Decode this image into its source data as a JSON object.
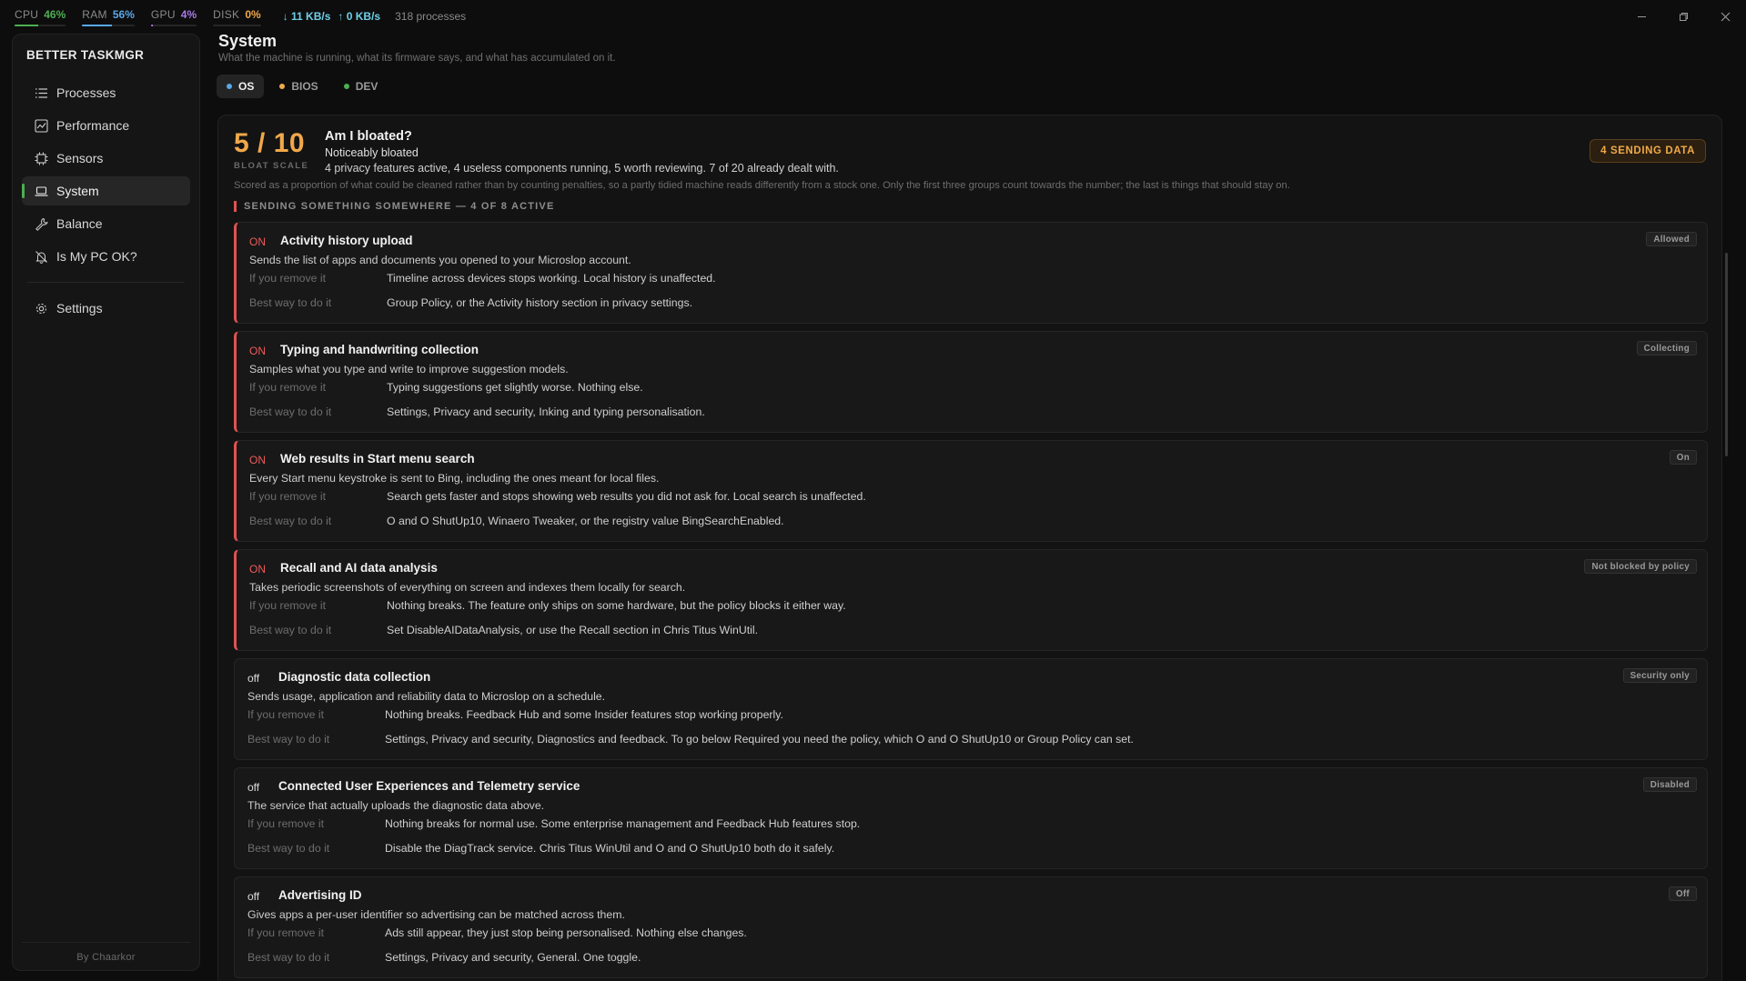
{
  "stats": [
    {
      "label": "CPU",
      "value": "46%",
      "percent": 46,
      "color": "#4caf50"
    },
    {
      "label": "RAM",
      "value": "56%",
      "percent": 56,
      "color": "#5aa7e8"
    },
    {
      "label": "GPU",
      "value": "4%",
      "percent": 4,
      "color": "#a879e8"
    },
    {
      "label": "DISK",
      "value": "0%",
      "percent": 0,
      "color": "#f0a84a"
    }
  ],
  "net": {
    "down": "↓ 11 KB/s",
    "up": "↑ 0 KB/s"
  },
  "processes": "318 processes",
  "sidebar": {
    "brand": "BETTER TASKMGR",
    "items": [
      {
        "label": "Processes",
        "icon": "list-icon"
      },
      {
        "label": "Performance",
        "icon": "chart-icon"
      },
      {
        "label": "Sensors",
        "icon": "chip-icon"
      },
      {
        "label": "System",
        "icon": "laptop-icon"
      },
      {
        "label": "Balance",
        "icon": "wrench-icon"
      },
      {
        "label": "Is My PC OK?",
        "icon": "bell-off-icon"
      }
    ],
    "settings": "Settings",
    "footer": "By Chaarkor"
  },
  "page": {
    "title": "System",
    "subtitle": "What the machine is running, what its firmware says, and what has accumulated on it.",
    "tabs": [
      {
        "label": "OS",
        "dot": "#5aa7e8"
      },
      {
        "label": "BIOS",
        "dot": "#f0a84a"
      },
      {
        "label": "DEV",
        "dot": "#4caf50"
      }
    ]
  },
  "bloat": {
    "score": "5 / 10",
    "scale_label": "BLOAT SCALE",
    "question": "Am I bloated?",
    "answer": "Noticeably bloated",
    "summary": "4 privacy features active, 4 useless components running, 5 worth reviewing. 7 of 20 already dealt with.",
    "note": "Scored as a proportion of what could be cleaned rather than by counting penalties, so a partly tidied machine reads differently from a stock one. Only the first three groups count towards the number; the last is things that should stay on.",
    "badge": "4 SENDING DATA",
    "section": "SENDING SOMETHING SOMEWHERE — 4 OF 8 ACTIVE"
  },
  "labels": {
    "remove": "If you remove it",
    "best": "Best way to do it"
  },
  "items": [
    {
      "state": "ON",
      "on": true,
      "name": "Activity history upload",
      "tag": "Allowed",
      "desc": "Sends the list of apps and documents you opened to your Microslop account.",
      "remove": "Timeline across devices stops working. Local history is unaffected.",
      "best": "Group Policy, or the Activity history section in privacy settings."
    },
    {
      "state": "ON",
      "on": true,
      "name": "Typing and handwriting collection",
      "tag": "Collecting",
      "desc": "Samples what you type and write to improve suggestion models.",
      "remove": "Typing suggestions get slightly worse. Nothing else.",
      "best": "Settings, Privacy and security, Inking and typing personalisation."
    },
    {
      "state": "ON",
      "on": true,
      "name": "Web results in Start menu search",
      "tag": "On",
      "desc": "Every Start menu keystroke is sent to Bing, including the ones meant for local files.",
      "remove": "Search gets faster and stops showing web results you did not ask for. Local search is unaffected.",
      "best": "O and O ShutUp10, Winaero Tweaker, or the registry value BingSearchEnabled."
    },
    {
      "state": "ON",
      "on": true,
      "name": "Recall and AI data analysis",
      "tag": "Not blocked by policy",
      "desc": "Takes periodic screenshots of everything on screen and indexes them locally for search.",
      "remove": "Nothing breaks. The feature only ships on some hardware, but the policy blocks it either way.",
      "best": "Set DisableAIDataAnalysis, or use the Recall section in Chris Titus WinUtil."
    },
    {
      "state": "off",
      "on": false,
      "name": "Diagnostic data collection",
      "tag": "Security only",
      "desc": "Sends usage, application and reliability data to Microslop on a schedule.",
      "remove": "Nothing breaks. Feedback Hub and some Insider features stop working properly.",
      "best": "Settings, Privacy and security, Diagnostics and feedback. To go below Required you need the policy, which O and O ShutUp10 or Group Policy can set."
    },
    {
      "state": "off",
      "on": false,
      "name": "Connected User Experiences and Telemetry service",
      "tag": "Disabled",
      "desc": "The service that actually uploads the diagnostic data above.",
      "remove": "Nothing breaks for normal use. Some enterprise management and Feedback Hub features stop.",
      "best": "Disable the DiagTrack service. Chris Titus WinUtil and O and O ShutUp10 both do it safely."
    },
    {
      "state": "off",
      "on": false,
      "name": "Advertising ID",
      "tag": "Off",
      "desc": "Gives apps a per-user identifier so advertising can be matched across them.",
      "remove": "Ads still appear, they just stop being personalised. Nothing else changes.",
      "best": "Settings, Privacy and security, General. One toggle."
    }
  ]
}
